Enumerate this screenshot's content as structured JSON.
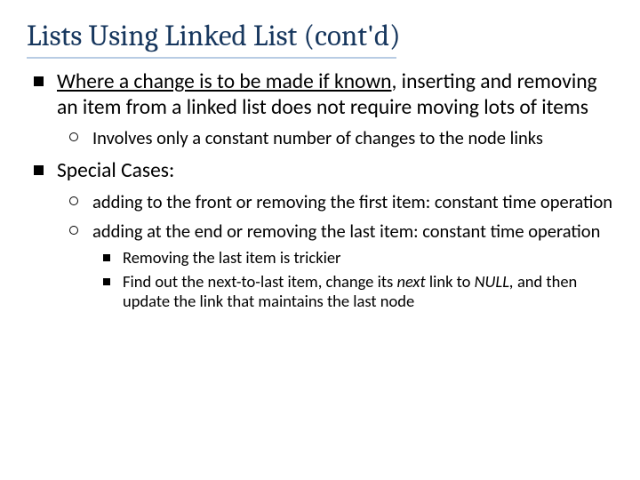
{
  "title": "Lists Using Linked List (cont'd)",
  "p1": {
    "u": "Where a change is to be made if known",
    "rest": ", inserting and removing an item from a linked list does not require moving lots of items",
    "sub1": "Involves only a constant number of changes to the node links"
  },
  "p2": {
    "head": "Special Cases:",
    "sub1": "adding to the front or removing the first item: constant time operation",
    "sub2": "adding at the end or removing the last item: constant time operation",
    "ssub1": "Removing the last item is trickier",
    "ssub2a": "Find out the next-to-last item, change its ",
    "ssub2_next": "next",
    "ssub2b": " link to ",
    "ssub2_null": "NULL, ",
    "ssub2c": "and then update the link that maintains the last node"
  }
}
